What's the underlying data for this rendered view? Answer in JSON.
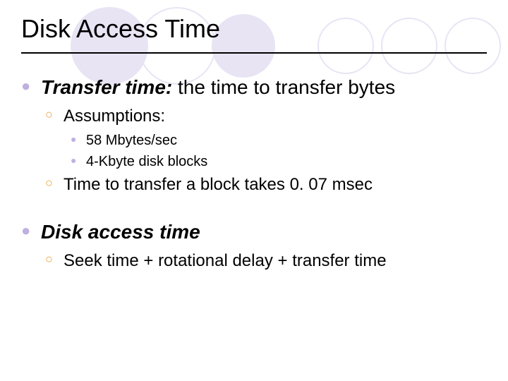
{
  "title": "Disk Access Time",
  "section1": {
    "head": "Transfer time:",
    "desc": "  the time to transfer bytes",
    "assumptions_label": "Assumptions:",
    "assumptions": {
      "a1": "58 Mbytes/sec",
      "a2": "4-Kbyte disk blocks"
    },
    "result": "Time to transfer a block takes 0. 07 msec"
  },
  "section2": {
    "head": "Disk access time",
    "formula": "Seek time + rotational delay + transfer time"
  }
}
